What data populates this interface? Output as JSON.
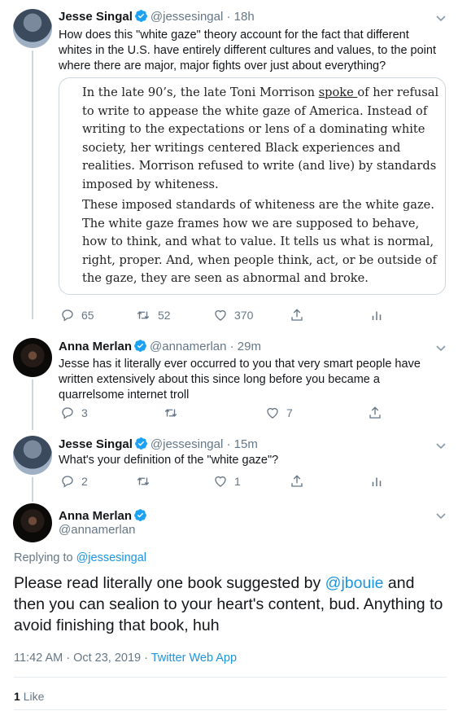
{
  "tweet1": {
    "author_name": "Jesse Singal",
    "author_handle": "@jessesingal",
    "time": "· 18h",
    "text": "How does this \"white gaze\" theory account for the fact that different whites in the U.S. have entirely different cultures and values, to the point where there are major, major fights over just about everything?",
    "quote": {
      "p1_a": "In the late 90’s, the late Toni Morrison ",
      "p1_link": "spoke ",
      "p1_b": "of her refusal to write to appease the white gaze of America. Instead of writing to the expectations or lens of a dominating white society, her writings centered Black experiences and realities. Morrison refused to write (and live) by standards imposed by whiteness.",
      "p2": "These imposed standards of whiteness are the white gaze. The white gaze frames how we are supposed to behave, how to think, and what to value. It tells us what is normal, right, proper. And, when people think, act, or be outside of the gaze, they are seen as abnormal and broke."
    },
    "replies": "65",
    "retweets": "52",
    "likes": "370"
  },
  "tweet2": {
    "author_name": "Anna Merlan",
    "author_handle": "@annamerlan",
    "time": "· 29m",
    "text": "Jesse has it literally ever occurred to you that very smart people have written extensively about this since long before you became a quarrelsome internet troll",
    "replies": "3",
    "retweets": "",
    "likes": "7"
  },
  "tweet3": {
    "author_name": "Jesse Singal",
    "author_handle": "@jessesingal",
    "time": "· 15m",
    "text": "What's your definition of the \"white gaze\"?",
    "replies": "2",
    "retweets": "",
    "likes": "1"
  },
  "main_tweet": {
    "author_name": "Anna Merlan",
    "author_handle": "@annamerlan",
    "replying_prefix": "Replying to ",
    "replying_to": "@jessesingal",
    "text_a": "Please read literally one book suggested by ",
    "mention": "@jbouie",
    "text_b": " and then you can sealion to your heart's content, bud. Anything to avoid finishing that book, huh",
    "timestamp": "11:42 AM · Oct 23, 2019 · ",
    "client": "Twitter Web App",
    "like_count": "1",
    "like_label": "Like"
  },
  "colors": {
    "verified": "#1da1f2",
    "link": "#1b95e0",
    "muted": "#657786"
  }
}
